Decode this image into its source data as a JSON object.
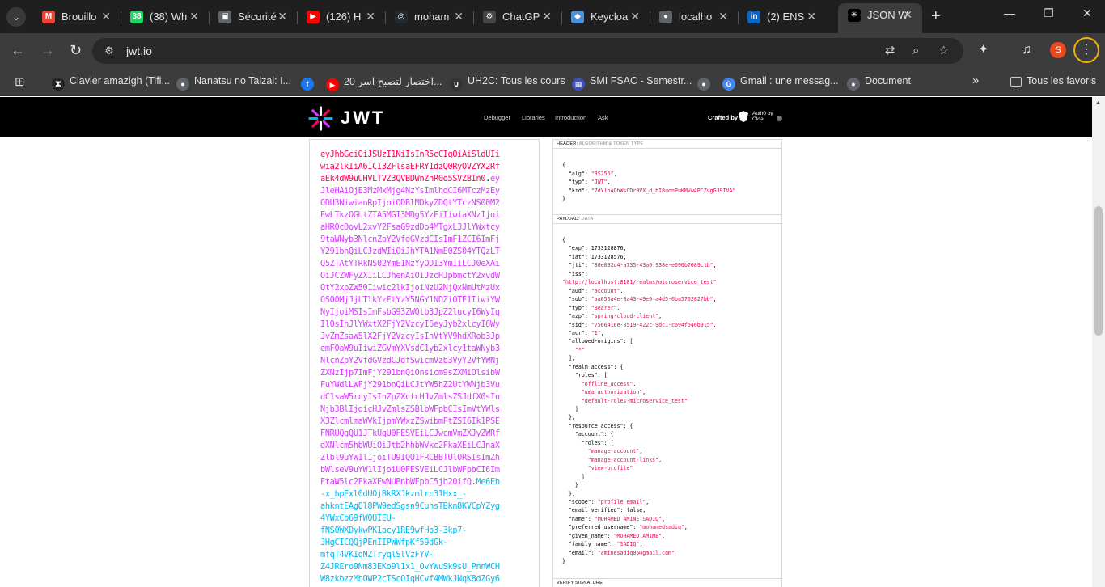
{
  "browser": {
    "tabs": [
      {
        "label": "Brouillo",
        "icon": "gmail-icon",
        "color": "#ea4335",
        "glyph": "M"
      },
      {
        "label": "(38) Wh",
        "icon": "whatsapp-icon",
        "color": "#25d366",
        "glyph": "38"
      },
      {
        "label": "Sécurité",
        "icon": "security-icon",
        "color": "#5f6368",
        "glyph": "▣"
      },
      {
        "label": "(126) H",
        "icon": "youtube-icon",
        "color": "#ff0000",
        "glyph": "▶"
      },
      {
        "label": "moham",
        "icon": "github-icon",
        "color": "#24292f",
        "glyph": "◎"
      },
      {
        "label": "ChatGP",
        "icon": "chatgpt-icon",
        "color": "#444444",
        "glyph": "⚙"
      },
      {
        "label": "Keycloa",
        "icon": "keycloak-icon",
        "color": "#4d8fd8",
        "glyph": "◆"
      },
      {
        "label": "localho",
        "icon": "globe-icon",
        "color": "#5f6368",
        "glyph": "●"
      },
      {
        "label": "(2) ENS",
        "icon": "linkedin-icon",
        "color": "#0a66c2",
        "glyph": "in"
      },
      {
        "label": "JSON W",
        "icon": "jwt-icon",
        "color": "#000000",
        "glyph": "✳"
      }
    ],
    "url": "jwt.io",
    "profile_initial": "S"
  },
  "bookmarks": [
    {
      "label": "Clavier amazigh (Tifi...",
      "icon": "amazigh-icon",
      "color": "#222222",
      "glyph": "ⵣ"
    },
    {
      "label": "Nanatsu no Taizai: I...",
      "icon": "globe-icon",
      "color": "#5f6368",
      "glyph": "●"
    },
    {
      "label": "",
      "icon": "facebook-icon",
      "color": "#1877f2",
      "glyph": "f"
    },
    {
      "label": "20 اختصار لتصبح اسر...",
      "icon": "youtube-icon",
      "color": "#ff0000",
      "glyph": "▶"
    },
    {
      "label": "UH2C: Tous les cours",
      "icon": "uh2c-icon",
      "color": "#333333",
      "glyph": "∪"
    },
    {
      "label": "SMI FSAC - Semestr...",
      "icon": "smi-icon",
      "color": "#3f51b5",
      "glyph": "▦"
    },
    {
      "label": "",
      "icon": "globe-icon",
      "color": "#5f6368",
      "glyph": "●"
    },
    {
      "label": "Gmail : une messag...",
      "icon": "google-icon",
      "color": "#4285f4",
      "glyph": "G"
    },
    {
      "label": "Document",
      "icon": "globe-icon",
      "color": "#5f6368",
      "glyph": "●"
    }
  ],
  "all_bookmarks_label": "Tous les favoris",
  "jwt_site": {
    "logo_text": "JWT",
    "nav": [
      "Debugger",
      "Libraries",
      "Introduction",
      "Ask"
    ],
    "crafted_by": "Crafted by",
    "auth0_label": "Auth0 by Okta",
    "encoded_lines": [
      {
        "parts": [
          {
            "t": "eyJhbGciOiJSUzI1NiIsInR5cCIgOiAiSldUIi",
            "c": "header"
          }
        ]
      },
      {
        "parts": [
          {
            "t": "wia2lkIiA6ICI3ZFlsaEFRY1dzQ0RyOVZYX2Rf",
            "c": "header"
          }
        ]
      },
      {
        "parts": [
          {
            "t": "aEk4dW9uUHVLTVZ3QVBDWnZnR0o5SVZBIn0",
            "c": "header"
          },
          {
            "t": ".",
            "c": "dot"
          },
          {
            "t": "ey",
            "c": "payload"
          }
        ]
      },
      {
        "parts": [
          {
            "t": "JleHAiOjE3MzMxMjg4NzYsImlhdCI6MTczMzEy",
            "c": "payload"
          }
        ]
      },
      {
        "parts": [
          {
            "t": "ODU3NiwianRpIjoiODBlMDkyZDQtYTczNS00M2",
            "c": "payload"
          }
        ]
      },
      {
        "parts": [
          {
            "t": "EwLTkzOGUtZTA5MGI3MDg5YzFiIiwiaXNzIjoi",
            "c": "payload"
          }
        ]
      },
      {
        "parts": [
          {
            "t": "aHR0cDovL2xvY2FsaG9zdDo4MTgxL3JlYWxtcy",
            "c": "payload"
          }
        ]
      },
      {
        "parts": [
          {
            "t": "9taWNyb3NlcnZpY2VfdGVzdCIsImF1ZCI6ImFj",
            "c": "payload"
          }
        ]
      },
      {
        "parts": [
          {
            "t": "Y291bnQiLCJzdWIiOiJhYTA1NmE0ZS04YTQzLT",
            "c": "payload"
          }
        ]
      },
      {
        "parts": [
          {
            "t": "Q5ZTAtYTRkNS02YmE1NzYyODI3YmIiLCJ0eXAi",
            "c": "payload"
          }
        ]
      },
      {
        "parts": [
          {
            "t": "OiJCZWFyZXIiLCJhenAiOiJzcHJpbmctY2xvdW",
            "c": "payload"
          }
        ]
      },
      {
        "parts": [
          {
            "t": "QtY2xpZW50Iiwic2lkIjoiNzU2NjQxNmUtMzUx",
            "c": "payload"
          }
        ]
      },
      {
        "parts": [
          {
            "t": "OS00MjJjLTlkYzEtYzY5NGY1NDZiOTE1IiwiYW",
            "c": "payload"
          }
        ]
      },
      {
        "parts": [
          {
            "t": "NyIjoiMSIsImFsbG93ZWQtb3JpZ2lucyI6WyIq",
            "c": "payload"
          }
        ]
      },
      {
        "parts": [
          {
            "t": "Il0sInJlYWxtX2FjY2VzcyI6eyJyb2xlcyI6Wy",
            "c": "payload"
          }
        ]
      },
      {
        "parts": [
          {
            "t": "JvZmZsaW5lX2FjY2VzcyIsInVtYV9hdXRob3Jp",
            "c": "payload"
          }
        ]
      },
      {
        "parts": [
          {
            "t": "emF0aW9uIiwiZGVmYXVsdC1yb2xlcy1taWNyb3",
            "c": "payload"
          }
        ]
      },
      {
        "parts": [
          {
            "t": "NlcnZpY2VfdGVzdCJdfSwicmVzb3VyY2VfYWNj",
            "c": "payload"
          }
        ]
      },
      {
        "parts": [
          {
            "t": "ZXNzIjp7ImFjY291bnQiOnsicm9sZXMiOlsibW",
            "c": "payload"
          }
        ]
      },
      {
        "parts": [
          {
            "t": "FuYWdlLWFjY291bnQiLCJtYW5hZ2UtYWNjb3Vu",
            "c": "payload"
          }
        ]
      },
      {
        "parts": [
          {
            "t": "dC1saW5rcyIsInZpZXctcHJvZmlsZSJdfX0sIn",
            "c": "payload"
          }
        ]
      },
      {
        "parts": [
          {
            "t": "Njb3BlIjoicHJvZmlsZSBlbWFpbCIsImVtYWls",
            "c": "payload"
          }
        ]
      },
      {
        "parts": [
          {
            "t": "X3ZlcmlmaWVkIjpmYWxzZSwibmFtZSI6Ik1PSE",
            "c": "payload"
          }
        ]
      },
      {
        "parts": [
          {
            "t": "FNRUQgQU1JTkUgU0FESVEiLCJwcmVmZXJyZWRf",
            "c": "payload"
          }
        ]
      },
      {
        "parts": [
          {
            "t": "dXNlcm5hbWUiOiJtb2hhbWVkc2FkaXEiLCJnaX",
            "c": "payload"
          }
        ]
      },
      {
        "parts": [
          {
            "t": "Zlbl9uYW1lIjoiTU9IQU1FRCBBTUlORSIsImZh",
            "c": "payload"
          }
        ]
      },
      {
        "parts": [
          {
            "t": "bWlseV9uYW1lIjoiU0FESVEiLCJlbWFpbCI6Im",
            "c": "payload"
          }
        ]
      },
      {
        "parts": [
          {
            "t": "FtaW5lc2FkaXEwNUBnbWFpbC5jb20ifQ",
            "c": "payload"
          },
          {
            "t": ".",
            "c": "dot"
          },
          {
            "t": "Me6Eb",
            "c": "sig"
          }
        ]
      },
      {
        "parts": [
          {
            "t": "-x_hpExl0dUOjBkRXJkzmlrc31Hxx_-",
            "c": "sig"
          }
        ]
      },
      {
        "parts": [
          {
            "t": "ahkntEAgOl8PW9edSgsn9CuhsTBkn8KVCpYZyg",
            "c": "sig"
          }
        ]
      },
      {
        "parts": [
          {
            "t": "4YWxCb69fW0UIEU-",
            "c": "sig"
          }
        ]
      },
      {
        "parts": [
          {
            "t": "fNS0WXDykwPK1pcy1RE9wfHo3-3kp7-",
            "c": "sig"
          }
        ]
      },
      {
        "parts": [
          {
            "t": "JHgCICQQjPEnIIPWWfpKf59dGk-",
            "c": "sig"
          }
        ]
      },
      {
        "parts": [
          {
            "t": "mfqT4VKIqNZTryqlSlVzFYV-",
            "c": "sig"
          }
        ]
      },
      {
        "parts": [
          {
            "t": "Z4JREro9Nm83EKo9l1x1_OvYWuSk9sU_PnnWCH",
            "c": "sig"
          }
        ]
      },
      {
        "parts": [
          {
            "t": "W8zkbzzMbOWP2cTScOIqHCvf4MWkJNqK8dZGy6",
            "c": "sig"
          }
        ]
      }
    ],
    "header_section": {
      "title": "HEADER:",
      "subtitle": "ALGORITHM & TOKEN TYPE"
    },
    "header_json": [
      "{",
      "  \"alg\": \"RS256\",",
      "  \"typ\": \"JWT\",",
      "  \"kid\": \"7dYlhAQbWsCDr9VX_d_hI8uonPuKMVwAPCZvgGJ9IVA\"",
      "}"
    ],
    "payload_section": {
      "title": "PAYLOAD:",
      "subtitle": "DATA"
    },
    "payload_json": [
      "{",
      "  \"exp\": 1733128876,",
      "  \"iat\": 1733128576,",
      "  \"jti\": \"80e092d4-a735-43a0-938e-e090b7089c1b\",",
      "  \"iss\":",
      "\"http://localhost:8181/realms/microservice_test\",",
      "  \"aud\": \"account\",",
      "  \"sub\": \"aa056a4e-8a43-49e0-a4d5-6ba5762827bb\",",
      "  \"typ\": \"Bearer\",",
      "  \"azp\": \"spring-cloud-client\",",
      "  \"sid\": \"7566416e-3519-422c-9dc1-c694f546b915\",",
      "  \"acr\": \"1\",",
      "  \"allowed-origins\": [",
      "    \"*\"",
      "  ],",
      "  \"realm_access\": {",
      "    \"roles\": [",
      "      \"offline_access\",",
      "      \"uma_authorization\",",
      "      \"default-roles-microservice_test\"",
      "    ]",
      "  },",
      "  \"resource_access\": {",
      "    \"account\": {",
      "      \"roles\": [",
      "        \"manage-account\",",
      "        \"manage-account-links\",",
      "        \"view-profile\"",
      "      ]",
      "    }",
      "  },",
      "  \"scope\": \"profile email\",",
      "  \"email_verified\": false,",
      "  \"name\": \"MOHAMED AMINE SADIQ\",",
      "  \"preferred_username\": \"mohamedsadiq\",",
      "  \"given_name\": \"MOHAMED AMINE\",",
      "  \"family_name\": \"SADIQ\",",
      "  \"email\": \"aminesadiq05@gmail.com\"",
      "}"
    ],
    "verify_section": {
      "title": "VERIFY SIGNATURE",
      "subtitle": ""
    }
  }
}
